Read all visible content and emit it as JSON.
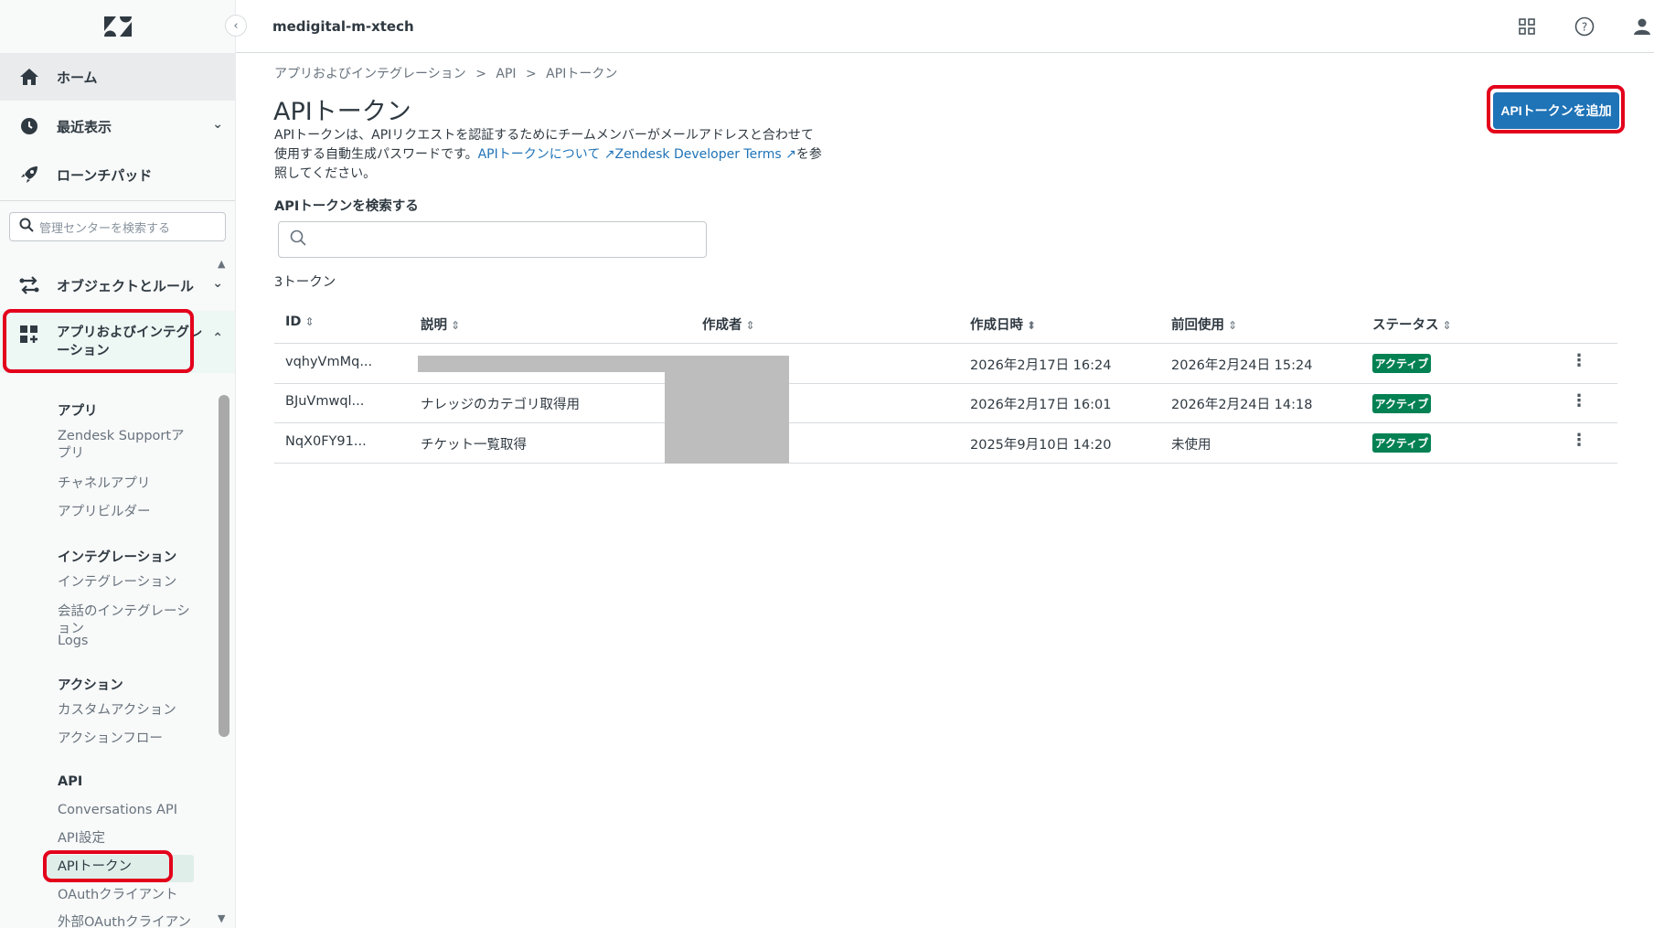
{
  "topbar": {
    "org_name": "medigital-m-xtech"
  },
  "sidebar": {
    "home": "ホーム",
    "recent": "最近表示",
    "launchpad": "ローンチパッド",
    "search_placeholder": "管理センターを検索する",
    "objects": "オブジェクトとルール",
    "apps_line1": "アプリおよびインテグレ",
    "apps_line2": "ーション",
    "sections": {
      "apps": {
        "heading": "アプリ",
        "items": [
          "Zendesk Supportアプリ",
          "チャネルアプリ",
          "アプリビルダー"
        ]
      },
      "integrations": {
        "heading": "インテグレーション",
        "items": [
          "インテグレーション",
          "会話のインテグレーション",
          "Logs"
        ]
      },
      "actions": {
        "heading": "アクション",
        "items": [
          "カスタムアクション",
          "アクションフロー"
        ]
      },
      "api": {
        "heading": "API",
        "items": [
          "Conversations API",
          "API設定",
          "APIトークン",
          "OAuthクライアント",
          "外部OAuthクライアント"
        ]
      }
    }
  },
  "breadcrumb": [
    "アプリおよびインテグレーション",
    ">",
    "API",
    ">",
    "APIトークン"
  ],
  "page": {
    "title": "APIトークン",
    "desc_text": "APIトークンは、APIリクエストを認証するためにチームメンバーがメールアドレスと合わせて使用する自動生成パスワードです。",
    "desc_link1": "APIトークンについて",
    "desc_link2": "Zendesk Developer Terms",
    "desc_tail": "を参照してください。",
    "add_button": "APIトークンを追加",
    "search_label": "APIトークンを検索する",
    "count": "3トークン"
  },
  "table": {
    "headers": [
      "ID",
      "説明",
      "作成者",
      "作成日時",
      "前回使用",
      "ステータス"
    ],
    "rows": [
      {
        "id": "vqhyVmMq...",
        "desc": "",
        "creator": "",
        "created": "2026年2月17日 16:24",
        "last_used": "2026年2月24日 15:24",
        "status": "アクティブ"
      },
      {
        "id": "BJuVmwql...",
        "desc": "ナレッジのカテゴリ取得用",
        "creator": "",
        "created": "2026年2月17日 16:01",
        "last_used": "2026年2月24日 14:18",
        "status": "アクティブ"
      },
      {
        "id": "NqX0FY91...",
        "desc": "チケット一覧取得",
        "creator": "",
        "created": "2025年9月10日 14:20",
        "last_used": "未使用",
        "status": "アクティブ"
      }
    ]
  },
  "colors": {
    "accent": "#1f73b7",
    "status_active": "#038153",
    "highlight": "#e3001b"
  },
  "icons": [
    "zendesk-logo",
    "home-icon",
    "clock-icon",
    "rocket-icon",
    "search-icon",
    "objects-rules-icon",
    "apps-grid-icon",
    "products-grid-icon",
    "help-icon",
    "user-icon"
  ]
}
